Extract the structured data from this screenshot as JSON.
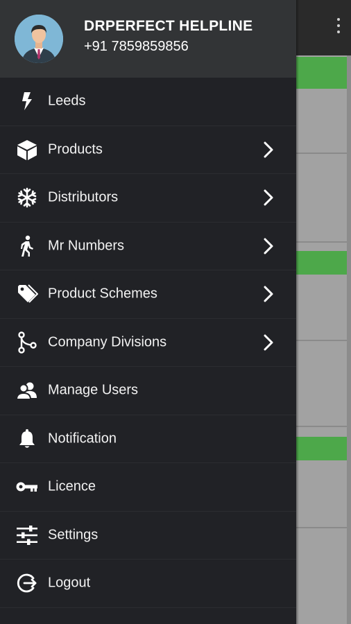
{
  "header": {
    "name": "DRPERFECT HELPLINE",
    "phone": "+91 7859859856"
  },
  "menu": {
    "items": [
      {
        "label": "Leeds",
        "icon": "lightning-icon",
        "has_submenu": false
      },
      {
        "label": "Products",
        "icon": "cube-icon",
        "has_submenu": true
      },
      {
        "label": "Distributors",
        "icon": "snowflake-icon",
        "has_submenu": true
      },
      {
        "label": "Mr Numbers",
        "icon": "walking-person-icon",
        "has_submenu": true
      },
      {
        "label": "Product Schemes",
        "icon": "tag-icon",
        "has_submenu": true
      },
      {
        "label": "Company Divisions",
        "icon": "branch-icon",
        "has_submenu": true
      },
      {
        "label": "Manage Users",
        "icon": "users-icon",
        "has_submenu": false
      },
      {
        "label": "Notification",
        "icon": "bell-icon",
        "has_submenu": false
      },
      {
        "label": "Licence",
        "icon": "key-icon",
        "has_submenu": false
      },
      {
        "label": "Settings",
        "icon": "sliders-icon",
        "has_submenu": false
      },
      {
        "label": "Logout",
        "icon": "logout-icon",
        "has_submenu": false
      }
    ]
  },
  "colors": {
    "drawer_bg": "#212226",
    "header_bg": "#323436",
    "accent_green": "#4da84a"
  }
}
